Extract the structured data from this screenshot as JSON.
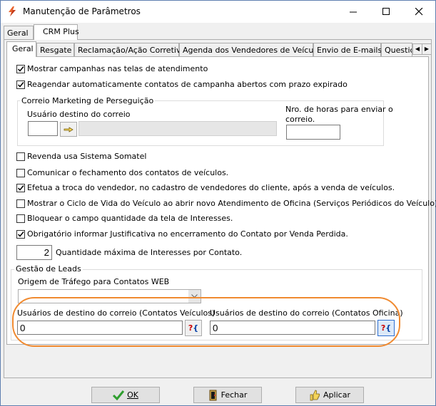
{
  "window": {
    "title": "Manutenção de Parâmetros",
    "icon": "lightning-logo-icon"
  },
  "outer_tabs": [
    "Geral",
    "CRM Plus"
  ],
  "inner_tabs": [
    "Geral",
    "Resgate",
    "Reclamação/Ação Corretiva",
    "Agenda dos Vendedores de Veículos",
    "Envio de E-mails",
    "Questic"
  ],
  "checks_top": [
    {
      "label": "Mostrar campanhas nas telas de atendimento",
      "checked": true
    },
    {
      "label": "Reagendar automaticamente contatos de campanha abertos com prazo expirado",
      "checked": true
    }
  ],
  "correio": {
    "title": "Correio Marketing de Perseguição",
    "user_label": "Usuário destino do correio",
    "user_value": "",
    "hours_label_1": "Nro. de horas para enviar o",
    "hours_label_2": "correio.",
    "hours_value": ""
  },
  "checks": [
    {
      "label": "Revenda usa Sistema Somatel",
      "checked": false
    },
    {
      "label": "Comunicar o fechamento dos contatos de veículos.",
      "checked": false
    },
    {
      "label": "Efetua a troca do vendedor,  no cadastro de vendedores do cliente, após a venda de veículos.",
      "checked": true
    },
    {
      "label": "Mostrar o Ciclo de Vida do Veículo ao abrir novo Atendimento de Oficina (Serviços Periódicos do Veículo).",
      "checked": false
    },
    {
      "label": "Bloquear o campo quantidade da tela de Interesses.",
      "checked": false
    },
    {
      "label": "Obrigatório informar Justificativa no encerramento do Contato por Venda Perdida.",
      "checked": true
    }
  ],
  "qty": {
    "value": "2",
    "label": "Quantidade máxima de Interesses por Contato."
  },
  "leads": {
    "title": "Gestão de Leads",
    "origem_label": "Origem de Tráfego para Contatos WEB",
    "origem_value": "",
    "veiculos_label": "Usuários de destino do correio (Contatos Veículos)",
    "veiculos_value": "0",
    "oficina_label": "Usuários de destino do correio (Contatos Oficina)",
    "oficina_value": "0"
  },
  "buttons": {
    "ok": "OK",
    "fechar": "Fechar",
    "aplicar": "Aplicar"
  },
  "colors": {
    "highlight": "#f08a30",
    "check": "#000000",
    "ok_icon": "#2e9e2e",
    "title_bg": "#ffffff"
  }
}
